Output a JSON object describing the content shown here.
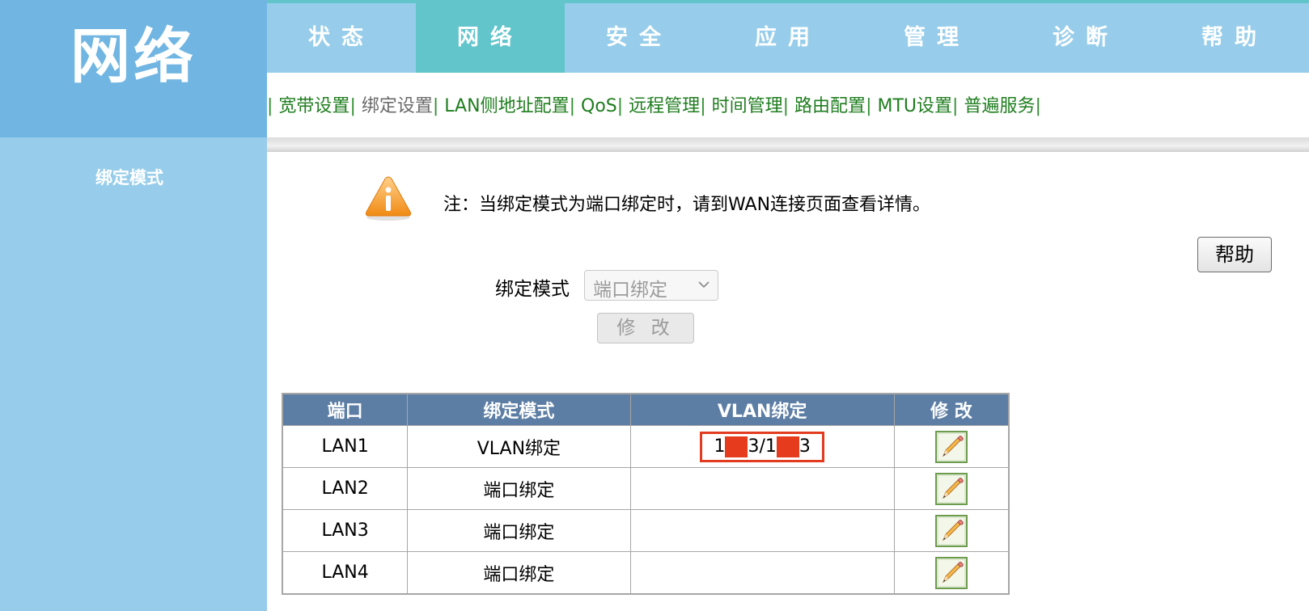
{
  "logo": {
    "title": "网络"
  },
  "nav": {
    "tabs": [
      {
        "label": "状态",
        "active": false
      },
      {
        "label": "网络",
        "active": true
      },
      {
        "label": "安全",
        "active": false
      },
      {
        "label": "应用",
        "active": false
      },
      {
        "label": "管理",
        "active": false
      },
      {
        "label": "诊断",
        "active": false
      },
      {
        "label": "帮助",
        "active": false
      }
    ]
  },
  "submenu": {
    "items": [
      {
        "label": "宽带设置",
        "active": false
      },
      {
        "label": "绑定设置",
        "active": true
      },
      {
        "label": "LAN侧地址配置",
        "active": false
      },
      {
        "label": "QoS",
        "active": false
      },
      {
        "label": "远程管理",
        "active": false
      },
      {
        "label": "时间管理",
        "active": false
      },
      {
        "label": "路由配置",
        "active": false
      },
      {
        "label": "MTU设置",
        "active": false
      },
      {
        "label": "普遍服务",
        "active": false
      }
    ],
    "separator": "|"
  },
  "sidebar": {
    "items": [
      {
        "label": "绑定模式"
      }
    ]
  },
  "main": {
    "note": "注：当绑定模式为端口绑定时，请到WAN连接页面查看详情。",
    "help_button": "帮助",
    "mode_label": "绑定模式",
    "mode_value": "端口绑定",
    "modify_button": "修 改"
  },
  "table": {
    "headers": [
      "端口",
      "绑定模式",
      "VLAN绑定",
      "修 改"
    ],
    "rows": [
      {
        "port": "LAN1",
        "mode": "VLAN绑定",
        "vlan_parts": [
          "1",
          "3/1",
          "3"
        ]
      },
      {
        "port": "LAN2",
        "mode": "端口绑定",
        "vlan_parts": []
      },
      {
        "port": "LAN3",
        "mode": "端口绑定",
        "vlan_parts": []
      },
      {
        "port": "LAN4",
        "mode": "端口绑定",
        "vlan_parts": []
      }
    ],
    "edit_icon": "pencil-icon"
  },
  "colors": {
    "logo_bg": "#71b6e2",
    "nav_bg": "#97cdea",
    "nav_active": "#62c5cc",
    "submenu_text": "#1f7d1f",
    "table_header": "#5d7ea4",
    "redaction": "#e63b1c",
    "highlight_border": "#e33b1f"
  }
}
